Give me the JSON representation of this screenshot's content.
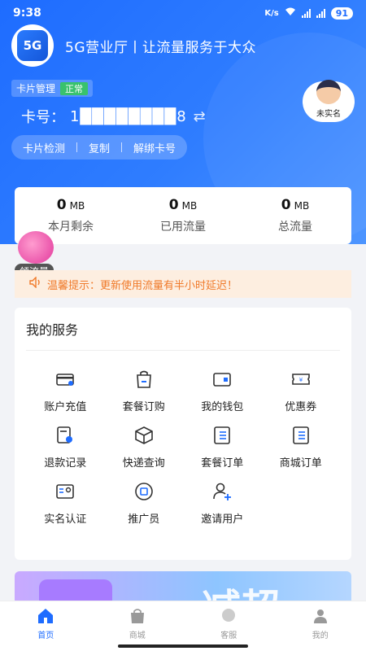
{
  "status_bar": {
    "time": "9:38",
    "network": "K/s",
    "battery": "91"
  },
  "brand": {
    "logo_text": "5G",
    "title": "5G营业厅丨让流量服务于大众"
  },
  "card": {
    "manage_label": "卡片管理",
    "status": "正常",
    "number_label": "卡号：",
    "number_value": "1████████8",
    "actions": [
      "卡片检测",
      "复制",
      "解绑卡号"
    ],
    "realname_status": "未实名"
  },
  "traffic": [
    {
      "value": "0",
      "unit": "MB",
      "label": "本月剩余"
    },
    {
      "value": "0",
      "unit": "MB",
      "label": "已用流量"
    },
    {
      "value": "0",
      "unit": "MB",
      "label": "总流量"
    }
  ],
  "gift": {
    "label": "领流量"
  },
  "notice": {
    "text": "温馨提示：更新使用流量有半小时延迟！"
  },
  "services": {
    "title": "我的服务",
    "items": [
      {
        "label": "账户充值",
        "icon": "card-icon"
      },
      {
        "label": "套餐订购",
        "icon": "shopping-bag-icon"
      },
      {
        "label": "我的钱包",
        "icon": "wallet-icon"
      },
      {
        "label": "优惠券",
        "icon": "coupon-icon"
      },
      {
        "label": "退款记录",
        "icon": "refund-icon"
      },
      {
        "label": "快递查询",
        "icon": "package-icon"
      },
      {
        "label": "套餐订单",
        "icon": "order-list-icon"
      },
      {
        "label": "商城订单",
        "icon": "mall-order-icon"
      },
      {
        "label": "实名认证",
        "icon": "id-card-icon"
      },
      {
        "label": "推广员",
        "icon": "promoter-icon"
      },
      {
        "label": "邀请用户",
        "icon": "invite-user-icon"
      }
    ]
  },
  "banner": {
    "text": "减超"
  },
  "tabbar": [
    {
      "label": "首页",
      "icon": "home-icon",
      "active": true
    },
    {
      "label": "商城",
      "icon": "shop-icon",
      "active": false
    },
    {
      "label": "客服",
      "icon": "service-icon",
      "active": false
    },
    {
      "label": "我的",
      "icon": "profile-icon",
      "active": false
    }
  ],
  "colors": {
    "primary": "#1e6cff",
    "notice": "#f07a2a",
    "success": "#39c26d"
  }
}
